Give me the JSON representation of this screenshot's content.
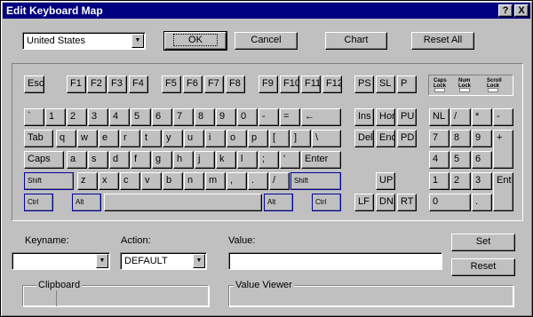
{
  "window": {
    "title": "Edit Keyboard Map",
    "help_label": "?",
    "close_label": "X"
  },
  "toolbar": {
    "country": "United States",
    "ok": "OK",
    "cancel": "Cancel",
    "chart": "Chart",
    "reset_all": "Reset All"
  },
  "keys": {
    "esc": "Esc",
    "f1": "F1",
    "f2": "F2",
    "f3": "F3",
    "f4": "F4",
    "f5": "F5",
    "f6": "F6",
    "f7": "F7",
    "f8": "F8",
    "f9": "F9",
    "f10": "F10",
    "f11": "F11",
    "f12": "F12",
    "ps": "PS",
    "sl": "SL",
    "p": "P",
    "r1": [
      "`",
      "1",
      "2",
      "3",
      "4",
      "5",
      "6",
      "7",
      "8",
      "9",
      "0",
      "-",
      "=",
      "←"
    ],
    "r2": [
      "Tab",
      "q",
      "w",
      "e",
      "r",
      "t",
      "y",
      "u",
      "i",
      "o",
      "p",
      "[",
      "]",
      "\\"
    ],
    "r3": [
      "Caps",
      "a",
      "s",
      "d",
      "f",
      "g",
      "h",
      "j",
      "k",
      "l",
      ";",
      "'",
      "Enter"
    ],
    "lshift": "Shift",
    "r4": [
      "z",
      "x",
      "c",
      "v",
      "b",
      "n",
      "m",
      ",",
      ".",
      "/"
    ],
    "rshift": "Shift",
    "lctrl": "Ctrl",
    "lalt": "Alt",
    "ralt": "Alt",
    "rctrl": "Ctrl",
    "ins": "Ins",
    "hom": "Hom",
    "pu": "PU",
    "del": "Del",
    "end": "End",
    "pd": "PD",
    "up": "UP",
    "lf": "LF",
    "dn": "DN",
    "rt": "RT",
    "nl": "NL",
    "slash": "/",
    "star": "*",
    "minus": "-",
    "n7": "7",
    "n8": "8",
    "n9": "9",
    "plus": "+",
    "n4": "4",
    "n5": "5",
    "n6": "6",
    "n1": "1",
    "n2": "2",
    "n3": "3",
    "ent": "Ent",
    "n0": "0",
    "dot": ".",
    "leds": [
      "Caps Lock",
      "Num Lock",
      "Scroll Lock"
    ]
  },
  "form": {
    "keyname_label": "Keyname:",
    "action_label": "Action:",
    "action_value": "DEFAULT",
    "value_label": "Value:",
    "set": "Set",
    "reset": "Reset",
    "clipboard_label": "Clipboard",
    "value_viewer_label": "Value Viewer"
  }
}
